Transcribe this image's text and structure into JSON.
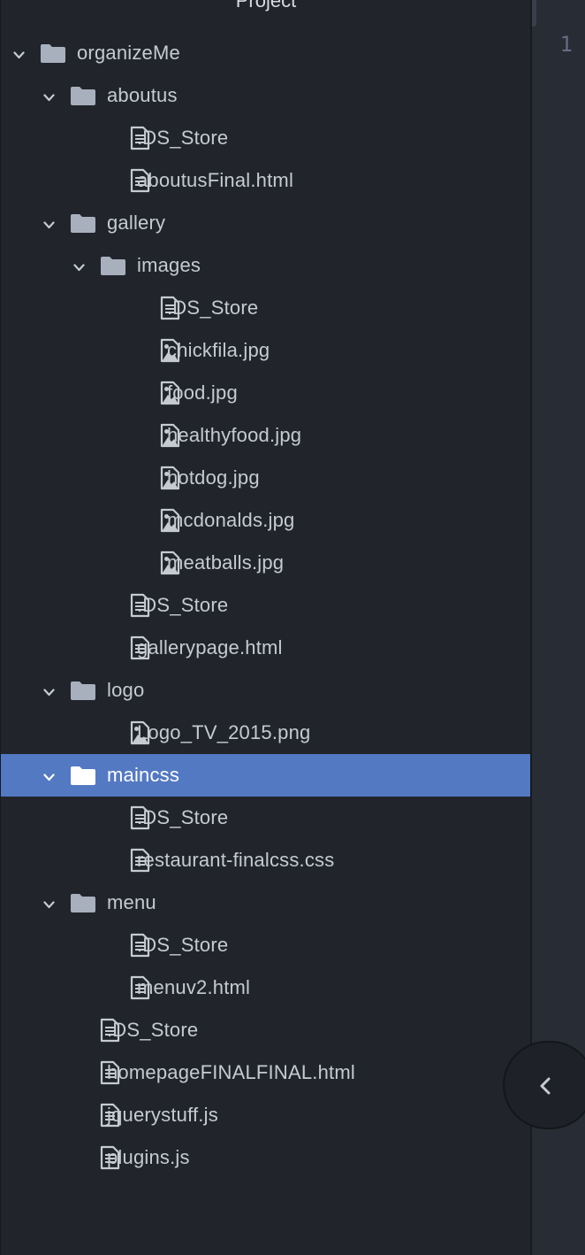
{
  "panel": {
    "title": "Project"
  },
  "editor": {
    "line_number": "1"
  },
  "colors": {
    "panel_background": "#21252b",
    "selection": "#5479c3",
    "text": "#c5cad3",
    "editor_background": "#282c34"
  },
  "tree": [
    {
      "label": "organizeMe",
      "type": "folder",
      "depth": 0,
      "expanded": true
    },
    {
      "label": "aboutus",
      "type": "folder",
      "depth": 1,
      "expanded": true
    },
    {
      "label": ".DS_Store",
      "type": "file",
      "depth": 2
    },
    {
      "label": "aboutusFinal.html",
      "type": "file",
      "depth": 2
    },
    {
      "label": "gallery",
      "type": "folder",
      "depth": 1,
      "expanded": true
    },
    {
      "label": "images",
      "type": "folder",
      "depth": 2,
      "expanded": true
    },
    {
      "label": ".DS_Store",
      "type": "file",
      "depth": 3
    },
    {
      "label": "chickfila.jpg",
      "type": "image",
      "depth": 3
    },
    {
      "label": "food.jpg",
      "type": "image",
      "depth": 3
    },
    {
      "label": "healthyfood.jpg",
      "type": "image",
      "depth": 3
    },
    {
      "label": "hotdog.jpg",
      "type": "image",
      "depth": 3
    },
    {
      "label": "mcdonalds.jpg",
      "type": "image",
      "depth": 3
    },
    {
      "label": "meatballs.jpg",
      "type": "image",
      "depth": 3
    },
    {
      "label": ".DS_Store",
      "type": "file",
      "depth": 2
    },
    {
      "label": "gallerypage.html",
      "type": "file",
      "depth": 2
    },
    {
      "label": "logo",
      "type": "folder",
      "depth": 1,
      "expanded": true
    },
    {
      "label": "Logo_TV_2015.png",
      "type": "image",
      "depth": 2
    },
    {
      "label": "maincss",
      "type": "folder",
      "depth": 1,
      "expanded": true,
      "selected": true
    },
    {
      "label": ".DS_Store",
      "type": "file",
      "depth": 2
    },
    {
      "label": "restaurant-finalcss.css",
      "type": "file",
      "depth": 2
    },
    {
      "label": "menu",
      "type": "folder",
      "depth": 1,
      "expanded": true
    },
    {
      "label": ".DS_Store",
      "type": "file",
      "depth": 2
    },
    {
      "label": "menuv2.html",
      "type": "file",
      "depth": 2
    },
    {
      "label": ".DS_Store",
      "type": "file",
      "depth": 1
    },
    {
      "label": "homepageFINALFINAL.html",
      "type": "file",
      "depth": 1
    },
    {
      "label": "jquerystuff.js",
      "type": "file",
      "depth": 1
    },
    {
      "label": "plugins.js",
      "type": "file",
      "depth": 1
    }
  ]
}
